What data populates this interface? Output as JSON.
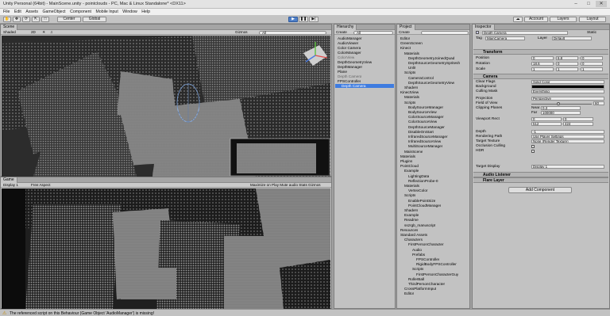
{
  "window": {
    "title": "Unity Personal (64bit) - MainScene.unity - pointclouds - PC, Mac & Linux Standalone* <DX11>"
  },
  "menu": [
    "File",
    "Edit",
    "Assets",
    "GameObject",
    "Component",
    "Mobile Input",
    "Window",
    "Help"
  ],
  "toolbar": {
    "center": "Center",
    "global": "Global",
    "account": "Account",
    "layers": "Layers",
    "layout": "Layout"
  },
  "scene": {
    "tab": "Scene",
    "shaded": "Shaded",
    "mode2d": "2D",
    "gizmos": "Gizmos",
    "search_placeholder": "All"
  },
  "game": {
    "tab": "Game",
    "display": "Display 1",
    "aspect": "Free Aspect",
    "toggles": "Maximize on Play  Mute audio  Stats  Gizmos"
  },
  "hierarchy": {
    "tab": "Hierarchy",
    "create": "Create",
    "search_placeholder": "All",
    "items": [
      "AudioManager",
      "AudioViewer",
      "Color Camera",
      "ColorManager",
      "ColorView",
      "DepthGeometryView",
      "DepthManager",
      "Plane",
      "Depth Camera",
      "FPSController",
      "Depth Camera"
    ],
    "selected_index": 10
  },
  "project": {
    "tab": "Project",
    "create": "Create",
    "items": [
      "Editor",
      "GreenScreen",
      "Kinect",
      "Materials",
      "DepthGeometryJoinedQuad",
      "DepthSourceGeometrySpritesh",
      "Unlit",
      "Scripts",
      "CameraControl",
      "DepthSourceGeometryView",
      "Shaders",
      "KinectView",
      "Materials",
      "Scripts",
      "BodySourceManager",
      "BodySourceView",
      "ColorSourceManager",
      "ColorSourceView",
      "DepthSourceManager",
      "DisableOnStart",
      "InfraredSourceManager",
      "InfraredSourceView",
      "MultiSourceManager",
      "MainScene",
      "Materials",
      "Plugins",
      "PointCloud",
      "Example",
      "LightingData",
      "ReflectionProbe-0",
      "Materials",
      "VertexColor",
      "Scripts",
      "EnablePointSize",
      "PointCloudManager",
      "Shaders",
      "Example",
      "Readme",
      "sszrgb_manuscript",
      "Resources",
      "Standard Assets",
      "Characters",
      "FirstPersonCharacter",
      "Audio",
      "Prefabs",
      "FPSController",
      "RigidBodyFPSController",
      "Scripts",
      "FirstPersonCharacterGuy",
      "RollerBall",
      "ThirdPersonCharacter",
      "CrossPlatformInput",
      "Editor"
    ]
  },
  "inspector": {
    "tab": "Inspector",
    "object_name": "Depth Camera",
    "static_label": "Static",
    "tag_label": "Tag",
    "tag_value": "MainCamera",
    "layer_label": "Layer",
    "layer_value": "Default",
    "transform": {
      "header": "Transform",
      "position": {
        "label": "Position",
        "x": "0",
        "y": "6.8",
        "z": "0"
      },
      "rotation": {
        "label": "Rotation",
        "x": "18.6",
        "y": "0",
        "z": "0"
      },
      "scale": {
        "label": "Scale",
        "x": "1",
        "y": "1",
        "z": "1"
      }
    },
    "camera": {
      "header": "Camera",
      "clear_flags": {
        "label": "Clear Flags",
        "value": "Solid Color"
      },
      "background": {
        "label": "Background",
        "color": "#000000"
      },
      "culling_mask": {
        "label": "Culling Mask",
        "value": "Everything"
      },
      "projection": {
        "label": "Projection",
        "value": "Perspective"
      },
      "fov": {
        "label": "Field of View",
        "value": "60"
      },
      "clipping": {
        "label": "Clipping Planes",
        "near_label": "Near",
        "near": "0.3",
        "far_label": "Far",
        "far": "100000"
      },
      "viewport": {
        "label": "Viewport Rect",
        "x": "0",
        "y": "0",
        "w": "512",
        "h": "424"
      },
      "depth": {
        "label": "Depth",
        "value": "-1"
      },
      "rendering_path": {
        "label": "Rendering Path",
        "value": "Use Player Settings"
      },
      "target_texture": {
        "label": "Target Texture",
        "value": "None (Render Texture)"
      },
      "occlusion": {
        "label": "Occlusion Culling"
      },
      "hdr": {
        "label": "HDR"
      },
      "target_display": {
        "label": "Target Display",
        "value": "Display 1"
      }
    },
    "audio_listener": "Audio Listener",
    "flare_layer": "Flare Layer",
    "add_component": "Add Component"
  },
  "status": {
    "message": "The referenced script on this Behaviour (Game Object 'AudioManager') is missing!"
  },
  "colors": {
    "accent": "#3e7ce0",
    "play": "#4f7fc7",
    "panel": "#c2c2c2"
  }
}
